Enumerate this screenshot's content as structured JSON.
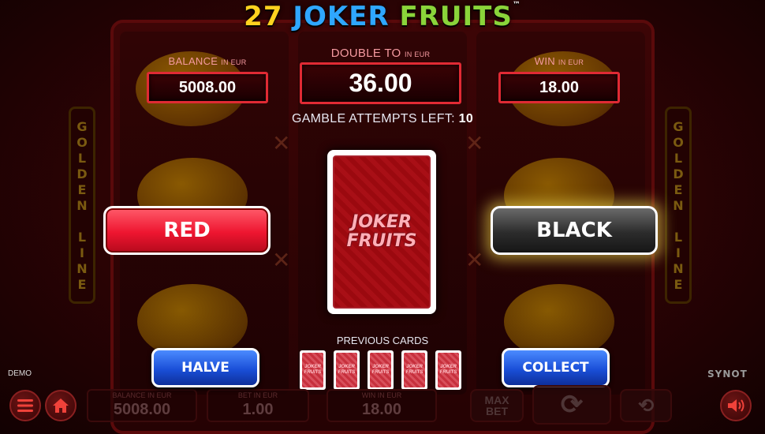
{
  "game": {
    "title_num": "27",
    "title_word1": "JOKER",
    "title_word2": "FRUITS",
    "trademark": "™"
  },
  "reels": {
    "golden_line_text": "GOLDEN LINE",
    "golden_line_letters": [
      "G",
      "O",
      "L",
      "D",
      "E",
      "N",
      "",
      "L",
      "I",
      "N",
      "E"
    ]
  },
  "balance": {
    "label": "BALANCE",
    "unit": "IN EUR",
    "value": "5008.00"
  },
  "double_to": {
    "label": "DOUBLE TO",
    "unit": "IN EUR",
    "value": "36.00"
  },
  "win": {
    "label": "WIN",
    "unit": "IN EUR",
    "value": "18.00"
  },
  "gamble": {
    "label": "GAMBLE ATTEMPTS LEFT:",
    "value": "10"
  },
  "buttons": {
    "red": "RED",
    "black": "BLACK",
    "halve": "HALVE",
    "collect": "COLLECT"
  },
  "card_back": {
    "line1": "JOKER",
    "line2": "FRUITS"
  },
  "previous_cards": {
    "label": "PREVIOUS CARDS",
    "cards": [
      {
        "line1": "JOKER",
        "line2": "FRUITS"
      },
      {
        "line1": "JOKER",
        "line2": "FRUITS"
      },
      {
        "line1": "JOKER",
        "line2": "FRUITS"
      },
      {
        "line1": "JOKER",
        "line2": "FRUITS"
      },
      {
        "line1": "JOKER",
        "line2": "FRUITS"
      }
    ]
  },
  "bottom_bar": {
    "demo_label": "DEMO",
    "brand": "SYNOT",
    "balance": {
      "label": "BALANCE IN EUR",
      "value": "5008.00"
    },
    "bet": {
      "label": "BET IN EUR",
      "value": "1.00"
    },
    "win": {
      "label": "WIN IN EUR",
      "value": "18.00"
    },
    "max_bet_line1": "MAX",
    "max_bet_line2": "BET"
  },
  "icons": {
    "menu": "menu-icon",
    "home": "home-icon",
    "spin": "spin-icon",
    "autoplay": "autoplay-icon",
    "sound": "sound-icon"
  },
  "colors": {
    "red_button": "#ee1530",
    "black_button": "#2c2c2c",
    "blue_button": "#1a4fd8",
    "value_border": "#e02a34",
    "black_glow": "#ffeb50"
  }
}
